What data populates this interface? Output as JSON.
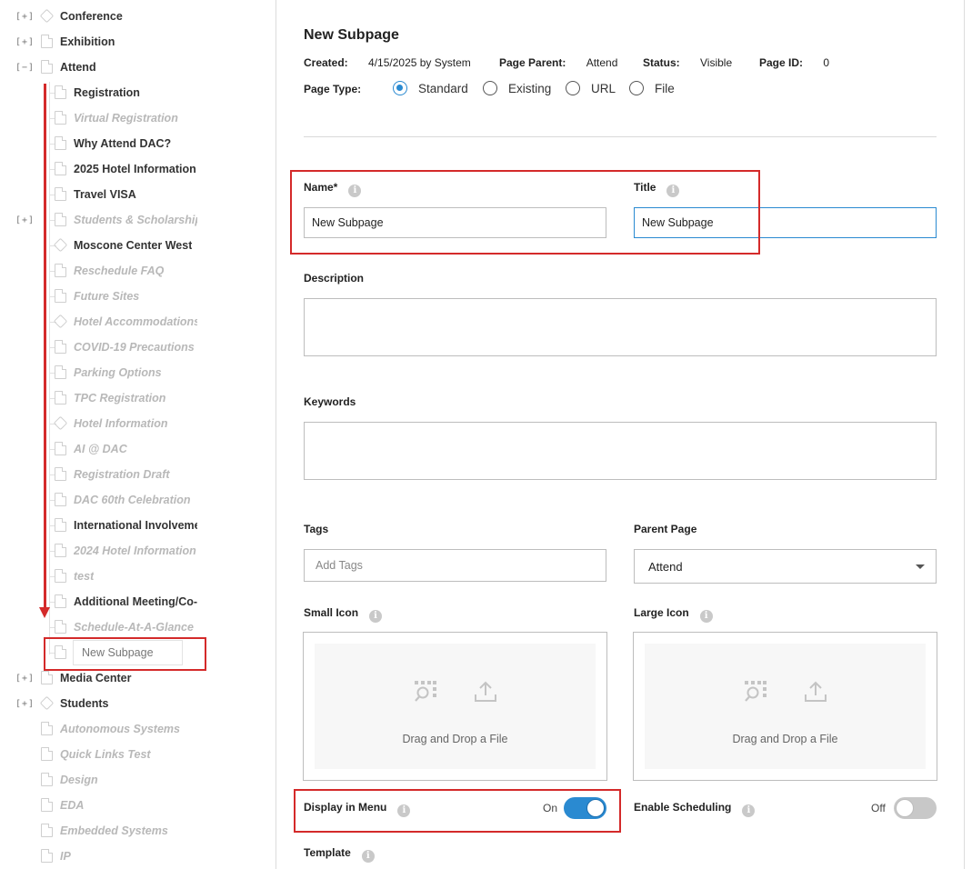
{
  "sidebar": {
    "items": [
      {
        "label": "Conference",
        "expander": "[+]",
        "level": 0,
        "icon": "tag-icon",
        "state": "normal"
      },
      {
        "label": "Exhibition",
        "expander": "[+]",
        "level": 0,
        "icon": "doc-icon",
        "state": "normal"
      },
      {
        "label": "Attend",
        "expander": "[−]",
        "level": 0,
        "icon": "doc-icon",
        "state": "normal"
      },
      {
        "label": "Registration",
        "expander": "",
        "level": 1,
        "icon": "doc-icon",
        "state": "bold"
      },
      {
        "label": "Virtual Registration",
        "expander": "",
        "level": 1,
        "icon": "doc-icon",
        "state": "muted"
      },
      {
        "label": "Why Attend DAC?",
        "expander": "",
        "level": 1,
        "icon": "doc-icon",
        "state": "bold"
      },
      {
        "label": "2025 Hotel Information",
        "expander": "",
        "level": 1,
        "icon": "doc-icon",
        "state": "bold"
      },
      {
        "label": "Travel VISA",
        "expander": "",
        "level": 1,
        "icon": "doc-icon",
        "state": "bold"
      },
      {
        "label": "Students & Scholarships",
        "expander": "[+]",
        "level": 1,
        "icon": "doc-icon",
        "state": "muted"
      },
      {
        "label": "Moscone Center West",
        "expander": "",
        "level": 1,
        "icon": "tag-icon",
        "state": "bold"
      },
      {
        "label": "Reschedule FAQ",
        "expander": "",
        "level": 1,
        "icon": "doc-icon",
        "state": "muted"
      },
      {
        "label": "Future Sites",
        "expander": "",
        "level": 1,
        "icon": "doc-icon",
        "state": "muted"
      },
      {
        "label": "Hotel Accommodations",
        "expander": "",
        "level": 1,
        "icon": "tag-icon",
        "state": "muted"
      },
      {
        "label": "COVID-19 Precautions",
        "expander": "",
        "level": 1,
        "icon": "doc-icon",
        "state": "muted"
      },
      {
        "label": "Parking Options",
        "expander": "",
        "level": 1,
        "icon": "doc-icon",
        "state": "muted"
      },
      {
        "label": "TPC Registration",
        "expander": "",
        "level": 1,
        "icon": "doc-icon",
        "state": "muted"
      },
      {
        "label": "Hotel Information",
        "expander": "",
        "level": 1,
        "icon": "tag-icon",
        "state": "muted"
      },
      {
        "label": "AI @ DAC",
        "expander": "",
        "level": 1,
        "icon": "doc-icon",
        "state": "muted"
      },
      {
        "label": "Registration Draft",
        "expander": "",
        "level": 1,
        "icon": "doc-icon",
        "state": "muted"
      },
      {
        "label": "DAC 60th Celebration",
        "expander": "",
        "level": 1,
        "icon": "doc-icon",
        "state": "muted"
      },
      {
        "label": "International Involvement",
        "expander": "",
        "level": 1,
        "icon": "doc-icon",
        "state": "bold"
      },
      {
        "label": "2024 Hotel Information",
        "expander": "",
        "level": 1,
        "icon": "doc-icon",
        "state": "muted"
      },
      {
        "label": "test",
        "expander": "",
        "level": 1,
        "icon": "doc-icon",
        "state": "muted"
      },
      {
        "label": "Additional Meeting/Co-Located",
        "expander": "",
        "level": 1,
        "icon": "doc-icon",
        "state": "bold"
      },
      {
        "label": "Schedule-At-A-Glance",
        "expander": "",
        "level": 1,
        "icon": "doc-icon",
        "state": "muted"
      },
      {
        "label": "New Subpage",
        "expander": "",
        "level": 1,
        "icon": "doc-icon",
        "state": "new"
      },
      {
        "label": "Media Center",
        "expander": "[+]",
        "level": 0,
        "icon": "doc-icon",
        "state": "normal"
      },
      {
        "label": "Students",
        "expander": "[+]",
        "level": 0,
        "icon": "tag-icon",
        "state": "normal"
      },
      {
        "label": "Autonomous Systems",
        "expander": "",
        "level": 0,
        "icon": "doc-icon",
        "state": "muted"
      },
      {
        "label": "Quick Links Test",
        "expander": "",
        "level": 0,
        "icon": "doc-icon",
        "state": "muted"
      },
      {
        "label": "Design",
        "expander": "",
        "level": 0,
        "icon": "doc-icon",
        "state": "muted"
      },
      {
        "label": "EDA",
        "expander": "",
        "level": 0,
        "icon": "doc-icon",
        "state": "muted"
      },
      {
        "label": "Embedded Systems",
        "expander": "",
        "level": 0,
        "icon": "doc-icon",
        "state": "muted"
      },
      {
        "label": "IP",
        "expander": "",
        "level": 0,
        "icon": "doc-icon",
        "state": "muted"
      }
    ]
  },
  "page": {
    "title": "New Subpage",
    "meta": {
      "created_label": "Created:",
      "created_value": "4/15/2025 by System",
      "parent_label": "Page Parent:",
      "parent_value": "Attend",
      "status_label": "Status:",
      "status_value": "Visible",
      "id_label": "Page ID:",
      "id_value": "0"
    },
    "page_type": {
      "label": "Page Type:",
      "options": [
        "Standard",
        "Existing",
        "URL",
        "File"
      ],
      "selected": "Standard"
    }
  },
  "form": {
    "name": {
      "label": "Name*",
      "value": "New Subpage"
    },
    "title": {
      "label": "Title",
      "value": "New Subpage"
    },
    "description": {
      "label": "Description",
      "value": ""
    },
    "keywords": {
      "label": "Keywords",
      "value": ""
    },
    "tags": {
      "label": "Tags",
      "placeholder": "Add Tags"
    },
    "parent_page": {
      "label": "Parent Page",
      "value": "Attend"
    },
    "small_icon": {
      "label": "Small Icon",
      "drop_text": "Drag and Drop a File"
    },
    "large_icon": {
      "label": "Large Icon",
      "drop_text": "Drag and Drop a File"
    },
    "display_in_menu": {
      "label": "Display in Menu",
      "state_text": "On",
      "on": true
    },
    "enable_scheduling": {
      "label": "Enable Scheduling",
      "state_text": "Off",
      "on": false
    },
    "template": {
      "label": "Template"
    }
  },
  "colors": {
    "accent": "#2a8ad1",
    "highlight": "#d42a2a",
    "muted_text": "#b8b8b8"
  }
}
